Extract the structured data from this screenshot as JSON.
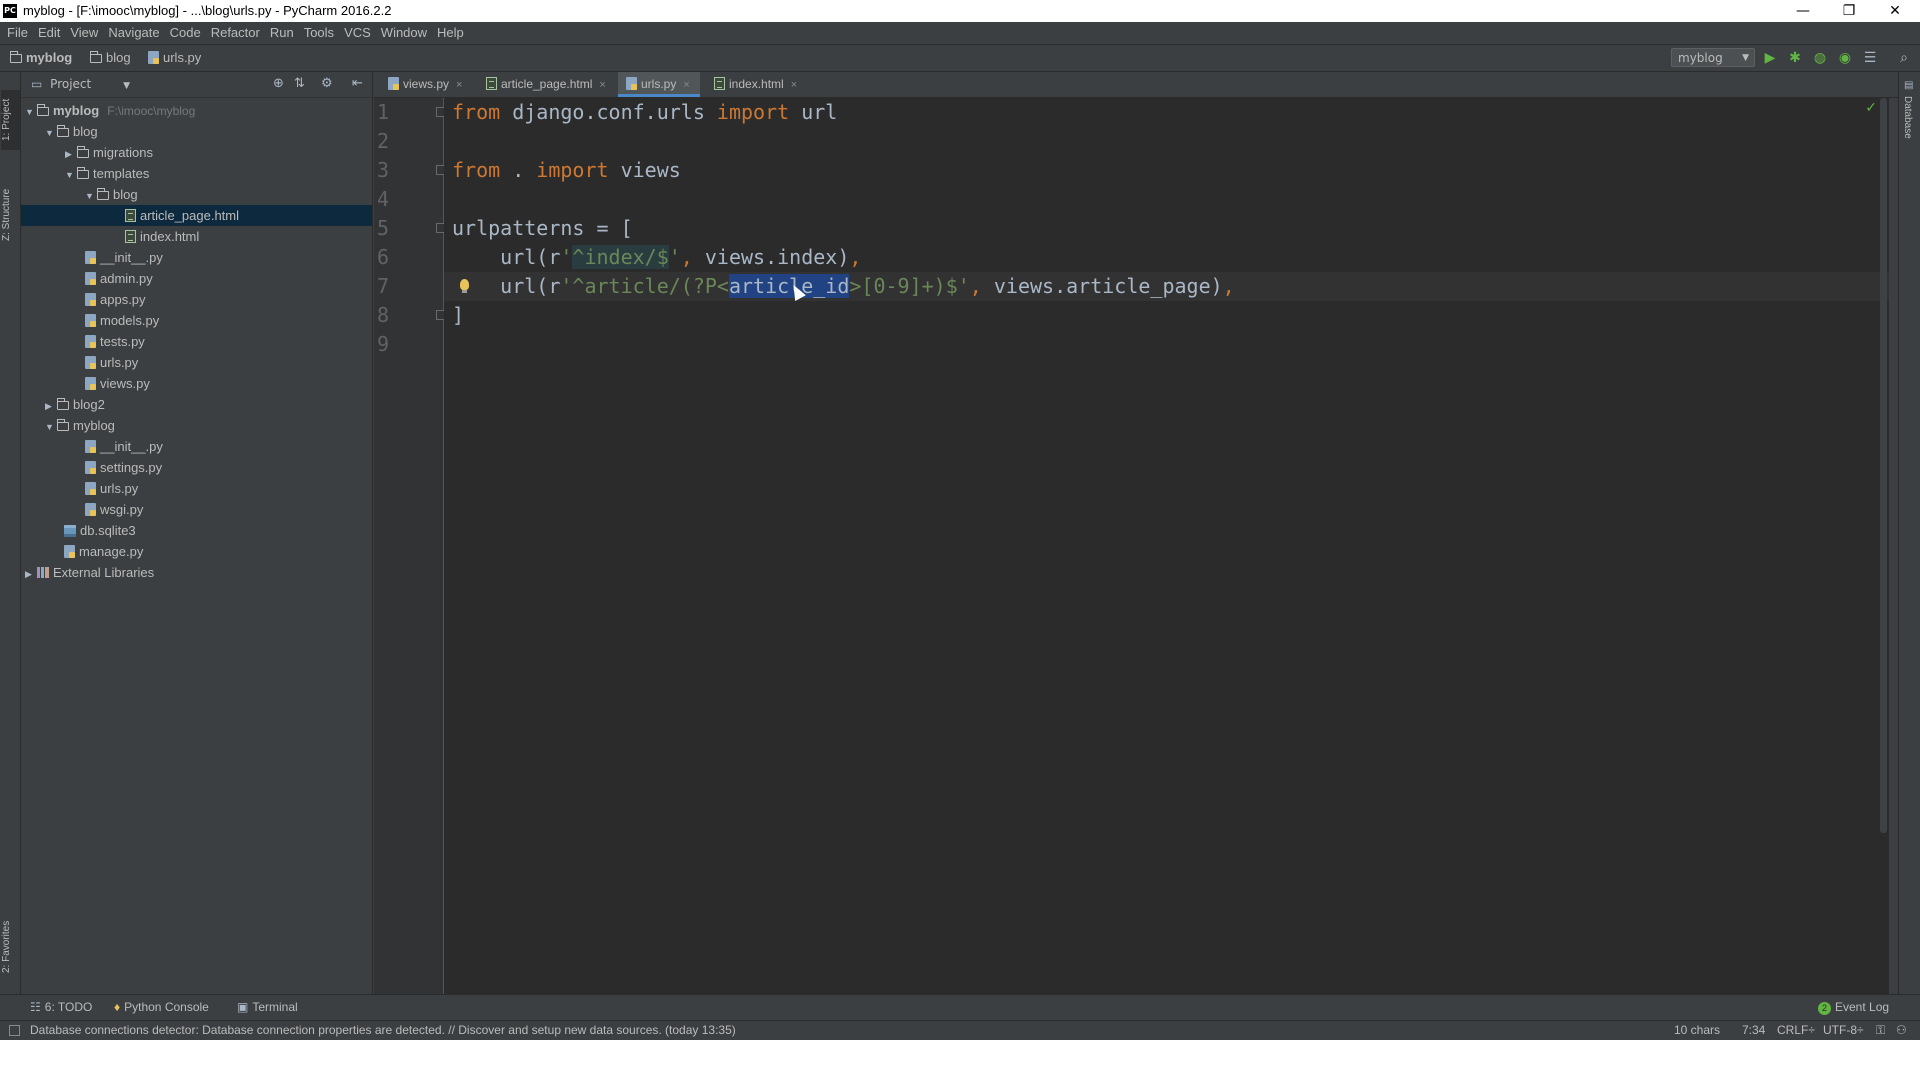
{
  "window": {
    "title": "myblog - [F:\\imooc\\myblog] - ...\\blog\\urls.py - PyCharm 2016.2.2",
    "app_icon": "PC",
    "controls": {
      "minimize": "—",
      "restore": "❐",
      "close": "✕"
    }
  },
  "menu": [
    "File",
    "Edit",
    "View",
    "Navigate",
    "Code",
    "Refactor",
    "Run",
    "Tools",
    "VCS",
    "Window",
    "Help"
  ],
  "breadcrumb": {
    "project": "myblog",
    "folder": "blog",
    "file": "urls.py"
  },
  "toolbar": {
    "run_config": "myblog"
  },
  "left_stripe": {
    "project_tab": "1: Project",
    "structure_tab": "Z: Structure",
    "favorites_tab": "2: Favorites"
  },
  "right_stripe": {
    "database_tab": "Database"
  },
  "project_panel": {
    "view_label": "Project",
    "tree": {
      "root": {
        "name": "myblog",
        "path": "F:\\imooc\\myblog"
      },
      "blog": "blog",
      "migrations": "migrations",
      "templates": "templates",
      "templates_blog": "blog",
      "article_page": "article_page.html",
      "index_html": "index.html",
      "blog_init": "__init__.py",
      "admin": "admin.py",
      "apps": "apps.py",
      "models": "models.py",
      "tests": "tests.py",
      "blog_urls": "urls.py",
      "views": "views.py",
      "blog2": "blog2",
      "myblog_pkg": "myblog",
      "myblog_init": "__init__.py",
      "settings": "settings.py",
      "myblog_urls": "urls.py",
      "wsgi": "wsgi.py",
      "db": "db.sqlite3",
      "manage": "manage.py",
      "external": "External Libraries"
    }
  },
  "editor_tabs": [
    {
      "label": "views.py",
      "close": "×"
    },
    {
      "label": "article_page.html",
      "close": "×"
    },
    {
      "label": "urls.py",
      "close": "×"
    },
    {
      "label": "index.html",
      "close": "×"
    }
  ],
  "editor": {
    "line_numbers": [
      "1",
      "2",
      "3",
      "4",
      "5",
      "6",
      "7",
      "8",
      "9"
    ],
    "line1": {
      "kw1": "from",
      "mod": " django.conf.urls ",
      "kw2": "import",
      "name": " url"
    },
    "line3": {
      "kw1": "from",
      "mod": " . ",
      "kw2": "import",
      "name": " views"
    },
    "line5": {
      "text": "urlpatterns = ["
    },
    "line6": {
      "pre": "    url(r",
      "s1": "'",
      "s2": "^index/$",
      "s3": "'",
      "comma": ",",
      "post": " views.index)",
      "trail": ","
    },
    "line7": {
      "pre": "    url(r",
      "s1": "'^article/(?P<",
      "selected": "article_id",
      "s2": ">[0-9]+)$'",
      "comma": ",",
      "post": " views.article_page)",
      "trail": ","
    },
    "line8": {
      "text": "]"
    }
  },
  "bottom_tools": {
    "todo": "6: TODO",
    "console": "Python Console",
    "terminal": "Terminal",
    "event_log": "Event Log"
  },
  "status": {
    "message": "Database connections detector: Database connection properties are detected. // Discover and setup new data sources. (today 13:35)",
    "chars": "10 chars",
    "position": "7:34",
    "line_sep": "CRLF÷",
    "encoding": "UTF-8÷"
  }
}
